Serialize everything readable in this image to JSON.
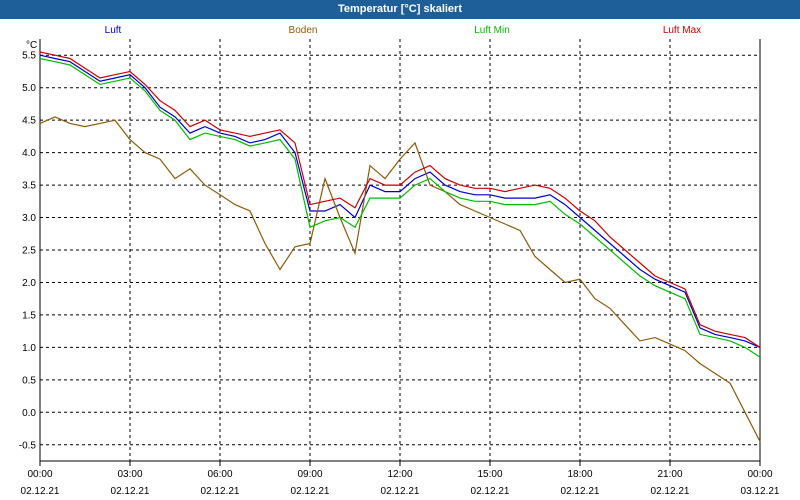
{
  "window": {
    "title": "Temperatur [°C] skaliert"
  },
  "chart_data": {
    "type": "line",
    "title": "Temperatur [°C] skaliert",
    "ylabel": "°C",
    "xlabel": "",
    "ylim": [
      -0.75,
      5.75
    ],
    "xlim": [
      0,
      24
    ],
    "yticks": [
      "5.5",
      "5.0",
      "4.5",
      "4.0",
      "3.5",
      "3.0",
      "2.5",
      "2.0",
      "1.5",
      "1.0",
      "0.5",
      "0.0",
      "-0.5"
    ],
    "xticks": [
      {
        "time": "00:00",
        "date": "02.12.21"
      },
      {
        "time": "03:00",
        "date": "02.12.21"
      },
      {
        "time": "06:00",
        "date": "02.12.21"
      },
      {
        "time": "09:00",
        "date": "02.12.21"
      },
      {
        "time": "12:00",
        "date": "02.12.21"
      },
      {
        "time": "15:00",
        "date": "02.12.21"
      },
      {
        "time": "18:00",
        "date": "02.12.21"
      },
      {
        "time": "21:00",
        "date": "02.12.21"
      },
      {
        "time": "00:00",
        "date": "03.12.21"
      }
    ],
    "grid": true,
    "legend_position": "top",
    "x_hours": [
      0,
      0.5,
      1,
      1.5,
      2,
      2.5,
      3,
      3.5,
      4,
      4.5,
      5,
      5.5,
      6,
      6.5,
      7,
      7.5,
      8,
      8.5,
      9,
      9.5,
      10,
      10.5,
      11,
      11.5,
      12,
      12.5,
      13,
      13.5,
      14,
      14.5,
      15,
      15.5,
      16,
      16.5,
      17,
      17.5,
      18,
      18.5,
      19,
      19.5,
      20,
      20.5,
      21,
      21.5,
      22,
      22.5,
      23,
      23.5,
      24
    ],
    "series": [
      {
        "name": "Luft",
        "color": "#0000cc",
        "values": [
          5.5,
          5.45,
          5.4,
          5.25,
          5.1,
          5.15,
          5.2,
          5.0,
          4.7,
          4.55,
          4.3,
          4.4,
          4.3,
          4.25,
          4.15,
          4.2,
          4.3,
          4.0,
          3.1,
          3.1,
          3.2,
          3.0,
          3.5,
          3.4,
          3.4,
          3.6,
          3.7,
          3.5,
          3.4,
          3.35,
          3.35,
          3.3,
          3.3,
          3.3,
          3.35,
          3.2,
          3.0,
          2.8,
          2.6,
          2.4,
          2.2,
          2.05,
          1.95,
          1.85,
          1.3,
          1.2,
          1.15,
          1.1,
          1.0
        ]
      },
      {
        "name": "Boden",
        "color": "#8b5a0a",
        "values": [
          4.45,
          4.55,
          4.45,
          4.4,
          4.45,
          4.5,
          4.2,
          4.0,
          3.9,
          3.6,
          3.75,
          3.5,
          3.35,
          3.2,
          3.1,
          2.6,
          2.2,
          2.55,
          2.6,
          3.6,
          3.0,
          2.45,
          3.8,
          3.6,
          3.9,
          4.15,
          3.5,
          3.4,
          3.2,
          3.1,
          3.0,
          2.9,
          2.8,
          2.4,
          2.2,
          2.0,
          2.05,
          1.75,
          1.6,
          1.35,
          1.1,
          1.15,
          1.05,
          0.95,
          0.75,
          0.6,
          0.45,
          0.0,
          -0.45
        ]
      },
      {
        "name": "Luft Min",
        "color": "#00bb00",
        "values": [
          5.45,
          5.4,
          5.35,
          5.2,
          5.05,
          5.1,
          5.15,
          4.95,
          4.65,
          4.5,
          4.2,
          4.3,
          4.25,
          4.2,
          4.1,
          4.15,
          4.2,
          3.9,
          2.85,
          2.95,
          3.0,
          2.85,
          3.3,
          3.3,
          3.3,
          3.5,
          3.6,
          3.4,
          3.3,
          3.25,
          3.25,
          3.2,
          3.2,
          3.2,
          3.25,
          3.05,
          2.9,
          2.7,
          2.5,
          2.3,
          2.1,
          1.95,
          1.85,
          1.75,
          1.2,
          1.15,
          1.1,
          1.0,
          0.85
        ]
      },
      {
        "name": "Luft Max",
        "color": "#cc0000",
        "values": [
          5.55,
          5.5,
          5.45,
          5.3,
          5.15,
          5.2,
          5.25,
          5.05,
          4.8,
          4.65,
          4.4,
          4.5,
          4.35,
          4.3,
          4.25,
          4.3,
          4.35,
          4.15,
          3.2,
          3.25,
          3.3,
          3.15,
          3.6,
          3.5,
          3.5,
          3.7,
          3.8,
          3.6,
          3.5,
          3.45,
          3.45,
          3.4,
          3.45,
          3.5,
          3.45,
          3.3,
          3.1,
          2.95,
          2.7,
          2.5,
          2.3,
          2.1,
          2.0,
          1.9,
          1.35,
          1.25,
          1.2,
          1.15,
          1.0
        ]
      }
    ]
  }
}
